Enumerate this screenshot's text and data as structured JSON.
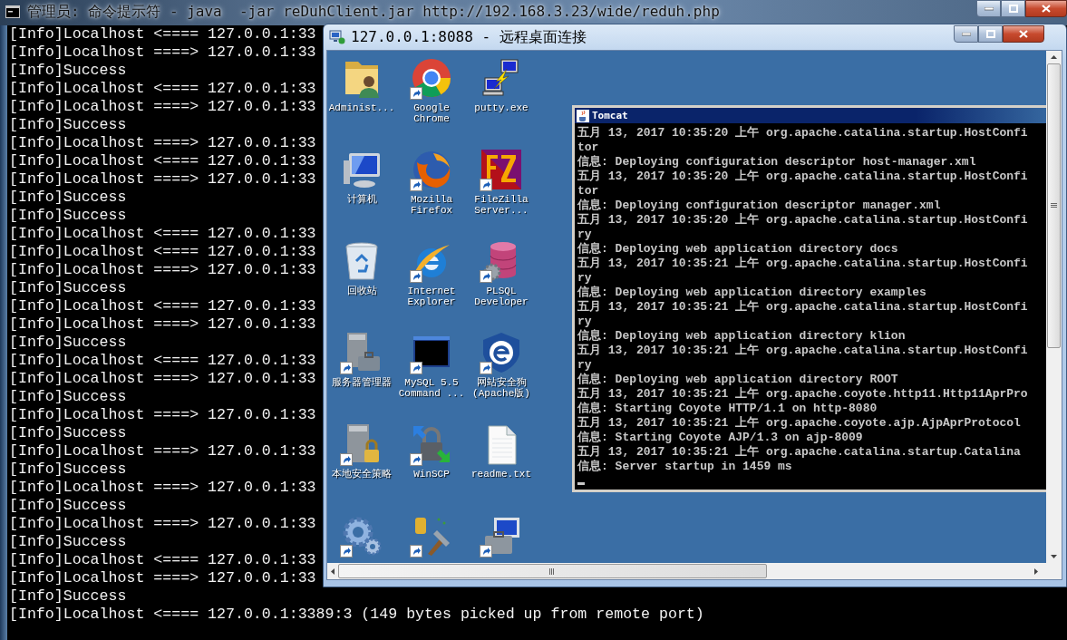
{
  "console_window": {
    "title": "管理员: 命令提示符 - java  -jar reDuhClient.jar http://192.168.3.23/wide/reduh.php",
    "lines": [
      "[Info]Localhost <==== 127.0.0.1:33",
      "[Info]Localhost ====> 127.0.0.1:33",
      "[Info]Success",
      "[Info]Localhost <==== 127.0.0.1:33",
      "[Info]Localhost ====> 127.0.0.1:33",
      "[Info]Success",
      "[Info]Localhost ====> 127.0.0.1:33",
      "[Info]Localhost <==== 127.0.0.1:33",
      "[Info]Localhost ====> 127.0.0.1:33",
      "[Info]Success",
      "[Info]Success",
      "[Info]Localhost <==== 127.0.0.1:33",
      "[Info]Localhost <==== 127.0.0.1:33",
      "[Info]Localhost ====> 127.0.0.1:33",
      "[Info]Success",
      "[Info]Localhost <==== 127.0.0.1:33",
      "[Info]Localhost ====> 127.0.0.1:33",
      "[Info]Success",
      "[Info]Localhost <==== 127.0.0.1:33",
      "[Info]Localhost ====> 127.0.0.1:33",
      "[Info]Success",
      "[Info]Localhost ====> 127.0.0.1:33",
      "[Info]Success",
      "[Info]Localhost ====> 127.0.0.1:33",
      "[Info]Success",
      "[Info]Localhost ====> 127.0.0.1:33",
      "[Info]Success",
      "[Info]Localhost ====> 127.0.0.1:33",
      "[Info]Success",
      "[Info]Localhost <==== 127.0.0.1:33",
      "[Info]Localhost ====> 127.0.0.1:33",
      "[Info]Success",
      "[Info]Localhost <==== 127.0.0.1:3389:3 (149 bytes picked up from remote port)"
    ]
  },
  "remote_desktop_window": {
    "title": "127.0.0.1:8088 - 远程桌面连接",
    "desktop_icons": [
      {
        "kind": "user-folder",
        "label": "Administ...",
        "shortcut": false
      },
      {
        "kind": "computer",
        "label": "计算机",
        "shortcut": false
      },
      {
        "kind": "recycle-bin",
        "label": "回收站",
        "shortcut": false
      },
      {
        "kind": "server-tools",
        "label": "服务器管理器",
        "shortcut": true
      },
      {
        "kind": "server-lock",
        "label": "本地安全策略",
        "shortcut": true
      },
      {
        "kind": "gears",
        "shortcut": true
      },
      {
        "kind": "chrome",
        "label": "Google Chrome",
        "shortcut": true
      },
      {
        "kind": "firefox",
        "label": "Mozilla Firefox",
        "shortcut": true
      },
      {
        "kind": "ie",
        "label": "Internet Explorer",
        "shortcut": true
      },
      {
        "kind": "console-window",
        "label": "MySQL 5.5 Command ...",
        "shortcut": true
      },
      {
        "kind": "padlock-arrows",
        "label": "WinSCP",
        "shortcut": true
      },
      {
        "kind": "tools",
        "shortcut": true
      },
      {
        "kind": "putty",
        "label": "putty.exe",
        "shortcut": false
      },
      {
        "kind": "filezilla",
        "label": "FileZilla Server...",
        "shortcut": true
      },
      {
        "kind": "database",
        "label": "PLSQL Developer",
        "shortcut": true
      },
      {
        "kind": "shield",
        "label": "网站安全狗(Apache版)",
        "shortcut": true
      },
      {
        "kind": "text-file",
        "label": "readme.txt",
        "shortcut": false
      },
      {
        "kind": "computer-tools",
        "shortcut": true
      }
    ],
    "tomcat_window": {
      "title": "Tomcat",
      "lines": [
        "五月 13, 2017 10:35:20 上午 org.apache.catalina.startup.HostConfi",
        "tor",
        "信息: Deploying configuration descriptor host-manager.xml",
        "五月 13, 2017 10:35:20 上午 org.apache.catalina.startup.HostConfi",
        "tor",
        "信息: Deploying configuration descriptor manager.xml",
        "五月 13, 2017 10:35:20 上午 org.apache.catalina.startup.HostConfi",
        "ry",
        "信息: Deploying web application directory docs",
        "五月 13, 2017 10:35:21 上午 org.apache.catalina.startup.HostConfi",
        "ry",
        "信息: Deploying web application directory examples",
        "五月 13, 2017 10:35:21 上午 org.apache.catalina.startup.HostConfi",
        "ry",
        "信息: Deploying web application directory klion",
        "五月 13, 2017 10:35:21 上午 org.apache.catalina.startup.HostConfi",
        "ry",
        "信息: Deploying web application directory ROOT",
        "五月 13, 2017 10:35:21 上午 org.apache.coyote.http11.Http11AprPro",
        "信息: Starting Coyote HTTP/1.1 on http-8080",
        "五月 13, 2017 10:35:21 上午 org.apache.coyote.ajp.AjpAprProtocol",
        "信息: Starting Coyote AJP/1.3 on ajp-8009",
        "五月 13, 2017 10:35:21 上午 org.apache.catalina.startup.Catalina",
        "信息: Server startup in 1459 ms"
      ]
    }
  }
}
